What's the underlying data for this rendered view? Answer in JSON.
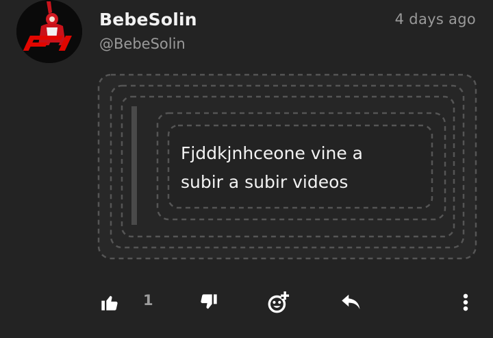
{
  "post": {
    "username": "BebeSolin",
    "handle": "@BebeSolin",
    "timestamp": "4 days ago",
    "message": "Fjddkjnhceone vine a subir a subir videos"
  },
  "actions": {
    "like_count": "1"
  },
  "icons": {
    "avatar": "f1-driver-avatar",
    "like": "thumbs-up-icon",
    "dislike": "thumbs-down-icon",
    "react": "add-reaction-icon",
    "reply": "reply-icon",
    "more": "more-vertical-icon"
  },
  "colors": {
    "background": "#232323",
    "text_primary": "#f2f2f2",
    "text_secondary": "#9a9a9a",
    "f1_red": "#e10600"
  }
}
